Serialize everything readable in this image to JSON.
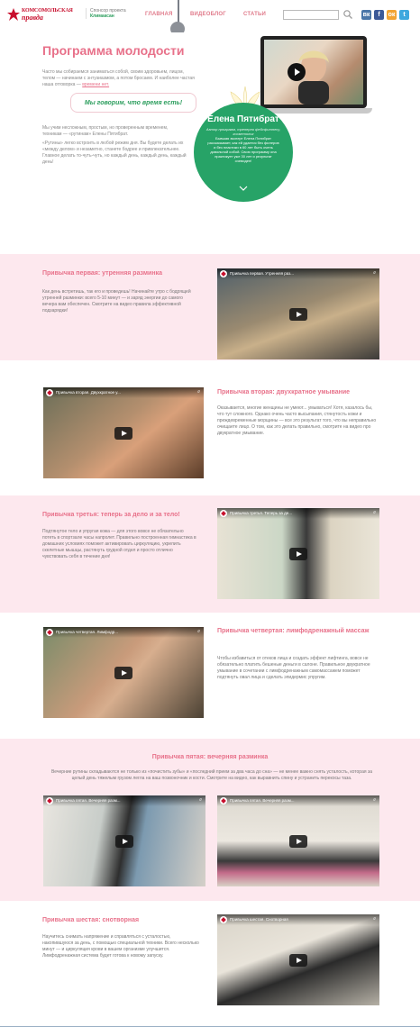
{
  "header": {
    "logo_line1": "КОМСОМОЛЬСКАЯ",
    "logo_line2": "правда",
    "sponsor_label": "Спонсор проекта",
    "sponsor_brand": "Климаксан",
    "nav": [
      "ГЛАВНАЯ",
      "ВИДЕОБЛОГ",
      "СТАТЬИ"
    ],
    "search_placeholder": "",
    "social": [
      {
        "name": "vk",
        "glyph": "вк",
        "color": "#4a76a8"
      },
      {
        "name": "fb",
        "glyph": "f",
        "color": "#3b5998"
      },
      {
        "name": "ok",
        "glyph": "ок",
        "color": "#f2a433"
      },
      {
        "name": "tw",
        "glyph": "t",
        "color": "#3ea8de"
      }
    ]
  },
  "hero": {
    "title": "Программа молодости",
    "p1": "Часто мы собираемся заниматься собой, своим здоровьем, лицом, телом — начинаем с энтузиазмом, а потом бросаем. И наиболее частая наша отговорка —",
    "p1_link": "времени нет.",
    "quote": "Мы говорим, что время есть!",
    "p2": "Мы учим несложным, простым, но проверенным временем, техникам — «рутинам» Елены Пятибрат.",
    "p3": "«Рутины» легко встроить в любой режим дня. Вы будете делать их «между делом» и незаметно, станете бодрее и привлекательнее. Главное делать то-чуть-чуть, но каждый день, каждый день, каждый день!",
    "circle_name": "Елена Пятибрат",
    "circle_sub": "Автор программ, тренерпо фейсфитнесу, косметолог",
    "circle_text": "Бывшая эксперт Елена Пятибрат рассказывает, как ей удается без филеров и без пластики в 60 лет быть очень довольной собой. Свою программу она практикует уже 30 лет и результат очевиден!"
  },
  "sections": [
    {
      "title": "Привычка первая: утренняя разминка",
      "text": "Как день встретишь, так его и проведешь! Начинайте утро с бодрящей утренней разминки: всего 5-10 минут — и заряд энергии до самого вечера вам обеспечен. Смотрите на видео правила эффективной подзарядки!",
      "video_title": "Привычка первая. Утренняя раз...",
      "share": "Поделиться"
    },
    {
      "title": "Привычка вторая: двухкратное умывание",
      "text": "Оказывается, многие женщины не умеют... умываться! Хотя, казалось бы, что тут сложного. Однако очень часто высыпания, стянутость кожи и преждевременные морщины — все это результат того, что вы неправильно очищаете лицо. О том, как это делать правильно, смотрите на видео про двукратное умывание.",
      "video_title": "Привычка вторая. Двухкратное у...",
      "share": "Поделиться"
    },
    {
      "title": "Привычка третья: теперь за дело и за тело!",
      "text": "Подтянутое тело и упругая кожа — для этого вовсе не обязательно потеть в спортзале часы напролет. Правильно построенная гимнастика в домашних условиях поможет активировать циркуляцию, укрепить скелетные мышцы, растянуть грудной отдел и просто отлично чувствовать себя в течение дня!",
      "video_title": "Привычка третья. Теперь за де...",
      "share": "Поделиться"
    },
    {
      "title": "Привычка четвертая: лимфодренажный массаж",
      "text": "Чтобы избавиться от отеков лица и создать эффект лифтинга, вовсе не обязательно платить бешеные деньги в салоне. Правильное двукратное умывание в сочетании с лимфодренажным самомассажем поможет подтянуть овал лица и сделать эпидермис упругим.",
      "video_title": "Привычка четвертая. Лимфодр...",
      "share": "Поделиться"
    },
    {
      "title": "Привычка пятая: вечерняя разминка",
      "text": "Вечерние рутины складываются не только из «почистить зубы» и «последний прием за два часа до сна» — не менее важно снять усталость, которая за целый день тяжелым грузом легла на ваш позвоночник и кости. Смотрите на видео, как выравнить спину и устранить перекосы таза.",
      "video_title": "Привычка пятая. Вечерняя разм...",
      "video_title2": "Привычка пятая. Вечерняя разм...",
      "share": "Поделиться"
    },
    {
      "title": "Привычка шестая: снотворная",
      "text": "Научитесь снимать напряжение и справляться с усталостью, накопившуюся за день, с помощью специальной техники. Всего несколько минут — и циркуляция крови в вашем организме улучшится. Лимфодренажная система будет готова к новому запуску.",
      "video_title": "Привычка шестая. Снотворная",
      "share": "Поделиться"
    }
  ]
}
